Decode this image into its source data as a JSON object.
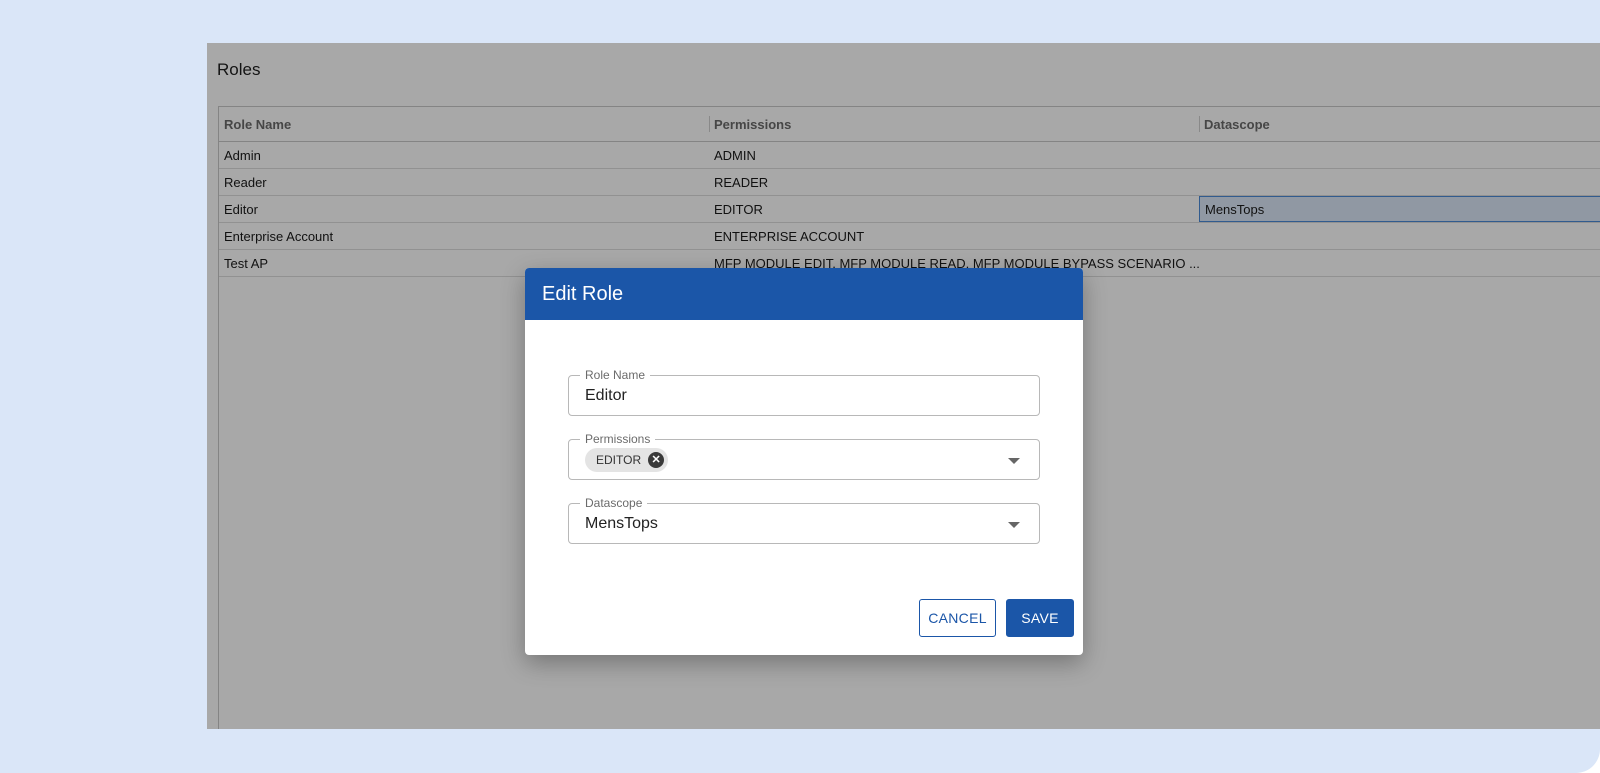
{
  "page": {
    "title": "Roles"
  },
  "grid": {
    "columns": [
      "Role Name",
      "Permissions",
      "Datascope"
    ],
    "rows": [
      {
        "role_name": "Admin",
        "permissions": "ADMIN",
        "datascope": ""
      },
      {
        "role_name": "Reader",
        "permissions": "READER",
        "datascope": ""
      },
      {
        "role_name": "Editor",
        "permissions": "EDITOR",
        "datascope": "MensTops"
      },
      {
        "role_name": "Enterprise Account",
        "permissions": "ENTERPRISE ACCOUNT",
        "datascope": ""
      },
      {
        "role_name": "Test AP",
        "permissions": "MFP MODULE EDIT, MFP MODULE READ, MFP MODULE BYPASS SCENARIO ...",
        "datascope": ""
      }
    ]
  },
  "dialog": {
    "title": "Edit Role",
    "role_name": {
      "label": "Role Name",
      "value": "Editor"
    },
    "permissions": {
      "label": "Permissions",
      "chips": [
        "EDITOR"
      ]
    },
    "datascope": {
      "label": "Datascope",
      "value": "MensTops"
    },
    "cancel_label": "CANCEL",
    "save_label": "SAVE"
  },
  "colors": {
    "accent": "#1b56a8",
    "background": "#dae6f8",
    "selection": "#4b8ad8"
  }
}
